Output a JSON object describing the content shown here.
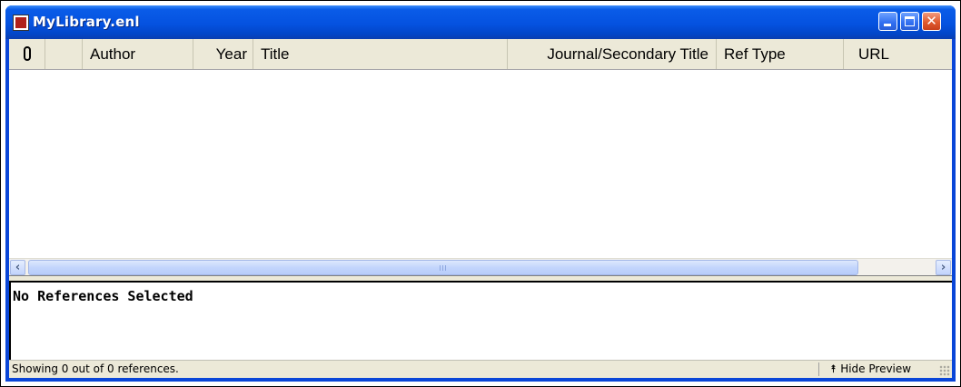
{
  "window": {
    "title": "MyLibrary.enl"
  },
  "columns": {
    "attachment_icon": "paperclip-icon",
    "pdf_icon": "pdf-icon",
    "author": "Author",
    "year": "Year",
    "title": "Title",
    "journal": "Journal/Secondary Title",
    "ref_type": "Ref Type",
    "url": "URL"
  },
  "references": [],
  "preview": {
    "text": "No References Selected"
  },
  "status": {
    "text": "Showing 0 out of 0 references.",
    "hide_preview": "Hide Preview"
  },
  "colors": {
    "titlebar": "#0a46d8",
    "close_button": "#e05a2e",
    "chrome": "#ece9d8",
    "scroll_thumb": "#c3d5fc"
  }
}
